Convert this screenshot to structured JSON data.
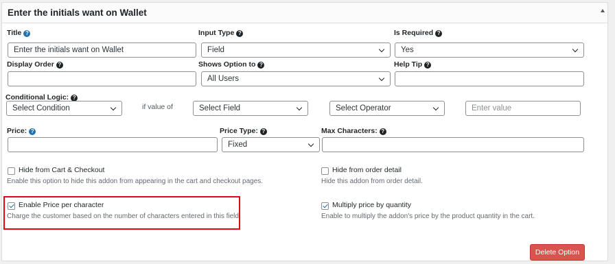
{
  "panel": {
    "title": "Enter the initials want on Wallet"
  },
  "fields": {
    "title": {
      "label": "Title",
      "value": "Enter the initials want on Wallet"
    },
    "input_type": {
      "label": "Input Type",
      "value": "Field"
    },
    "is_required": {
      "label": "Is Required",
      "value": "Yes"
    },
    "display_order": {
      "label": "Display Order",
      "value": ""
    },
    "shows_option_to": {
      "label": "Shows Option to",
      "value": "All Users"
    },
    "help_tip": {
      "label": "Help Tip",
      "value": ""
    }
  },
  "conditional": {
    "label": "Conditional Logic:",
    "condition_value": "Select Condition",
    "if_value_of": "if value of",
    "field_value": "Select Field",
    "operator_value": "Select Operator",
    "value_placeholder": "Enter value"
  },
  "pricing": {
    "price_label": "Price:",
    "price_value": "",
    "price_type_label": "Price Type:",
    "price_type_value": "Fixed",
    "max_chars_label": "Max Characters:",
    "max_chars_value": ""
  },
  "options": {
    "hide_cart": {
      "label": "Hide from Cart & Checkout",
      "desc": "Enable this option to hide this addon from appearing in the cart and checkout pages.",
      "checked": false
    },
    "hide_order": {
      "label": "Hide from order detail",
      "desc": "Hide this addon from order detail.",
      "checked": false
    },
    "price_per_char": {
      "label": "Enable Price per character",
      "desc": "Charge the customer based on the number of characters entered in this field.",
      "checked": true
    },
    "multiply_qty": {
      "label": "Multiply price by quantity",
      "desc": "Enable to multiply the addon's price by the product quantity in the cart.",
      "checked": true
    }
  },
  "actions": {
    "delete_label": "Delete Option"
  },
  "colors": {
    "highlight": "#e30613",
    "delete_button": "#d9534f",
    "checkbox_accent": "#2271b1"
  },
  "icons": {
    "help": "question-circle-icon",
    "collapse": "triangle-up-icon",
    "select": "chevron-down-icon"
  }
}
